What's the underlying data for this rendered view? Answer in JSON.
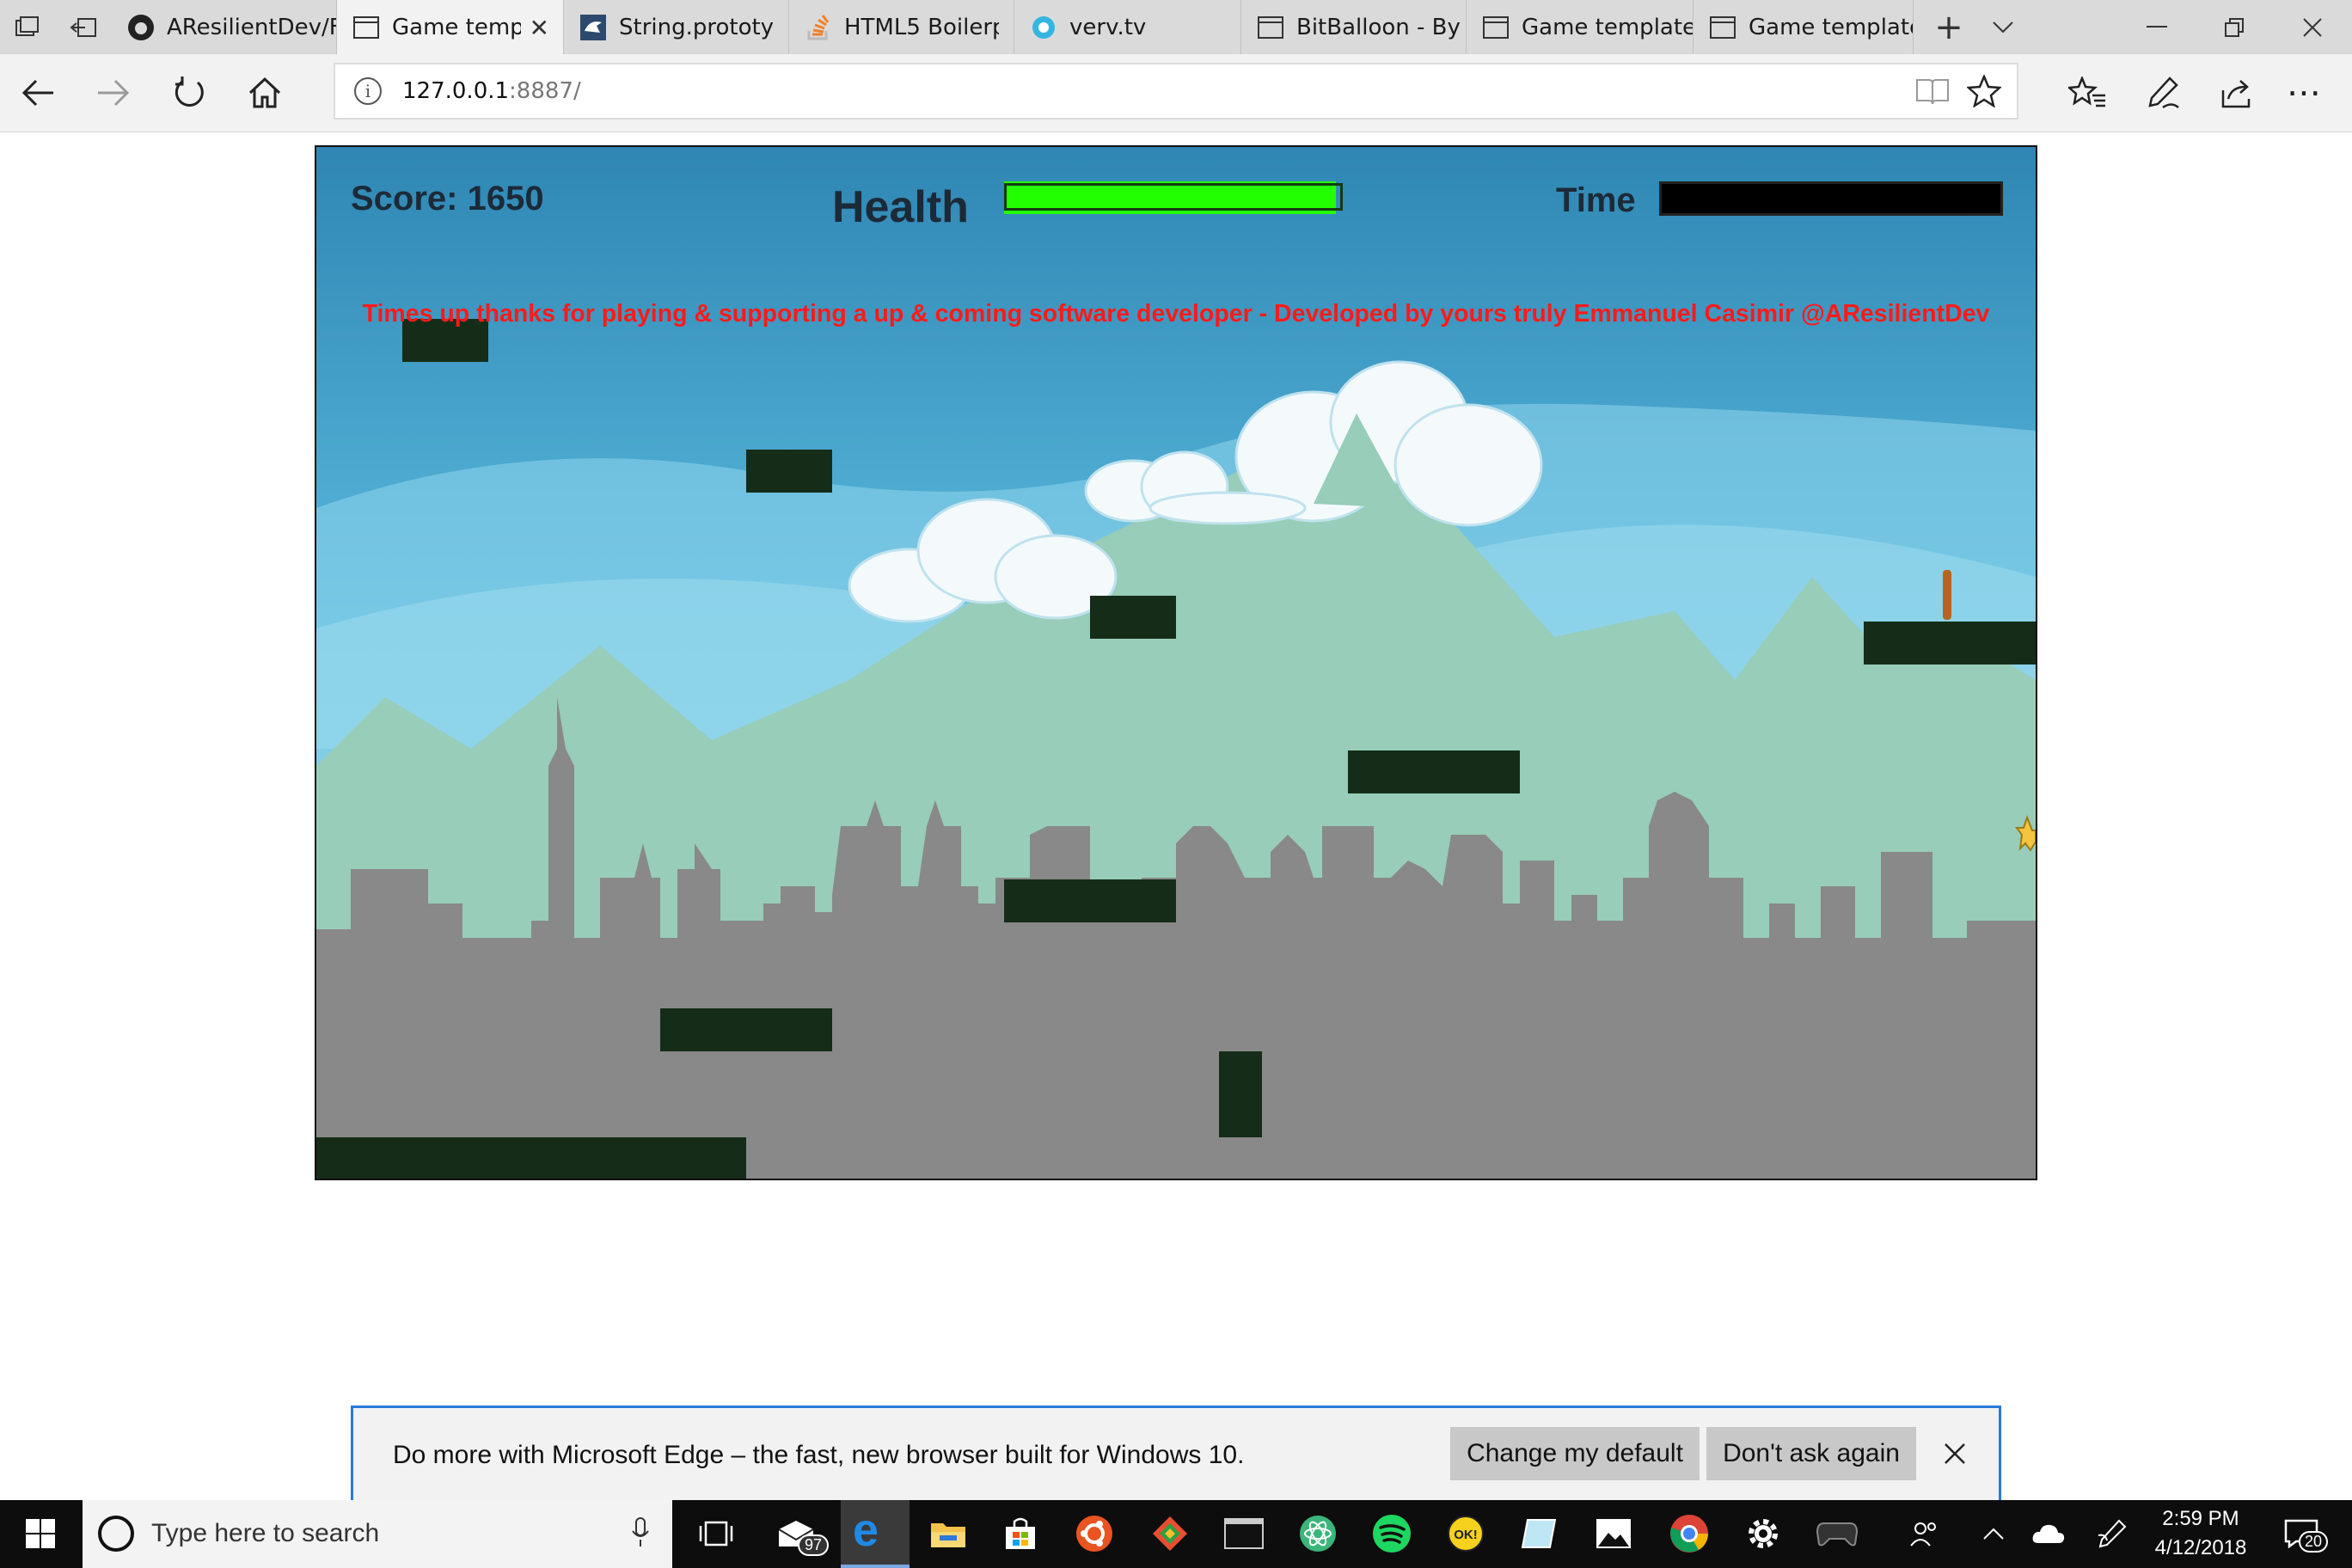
{
  "browser": {
    "tabs": [
      {
        "label": "AResilientDev/F",
        "icon": "github-icon",
        "active": false
      },
      {
        "label": "Game temp",
        "icon": "page-icon",
        "active": true
      },
      {
        "label": "String.prototype",
        "icon": "mdn-icon",
        "active": false
      },
      {
        "label": "HTML5 Boilerpl",
        "icon": "stackoverflow-icon",
        "active": false
      },
      {
        "label": "verv.tv",
        "icon": "verv-icon",
        "active": false
      },
      {
        "label": "BitBalloon - By",
        "icon": "page-icon",
        "active": false
      },
      {
        "label": "Game template",
        "icon": "page-icon",
        "active": false
      },
      {
        "label": "Game template",
        "icon": "page-icon",
        "active": false
      }
    ],
    "address": {
      "host": "127.0.0.1",
      "port": ":8887/"
    }
  },
  "game": {
    "score_label": "Score: 1650",
    "health_label": "Health",
    "time_label": "Time",
    "health_fraction": 0.92,
    "time_fraction": 0,
    "message": "Times up thanks for playing & supporting a up & coming software developer - Developed by yours truly Emmanuel Casimir @AResilientDev",
    "colors": {
      "sky_top": "#2f86b3",
      "sky_bottom": "#7fd3ea",
      "mountain": "#97cdb9",
      "city": "#898989",
      "platform": "#152d18",
      "health": "#22ff00",
      "message": "#ff1a1a"
    }
  },
  "notification": {
    "message": "Do more with Microsoft Edge – the fast, new browser built for Windows 10.",
    "change_default": "Change my default",
    "dont_ask": "Don't ask again"
  },
  "taskbar": {
    "search_placeholder": "Type here to search",
    "mail_badge": "97",
    "time": "2:59 PM",
    "date": "4/12/2018",
    "notifications": "20"
  }
}
